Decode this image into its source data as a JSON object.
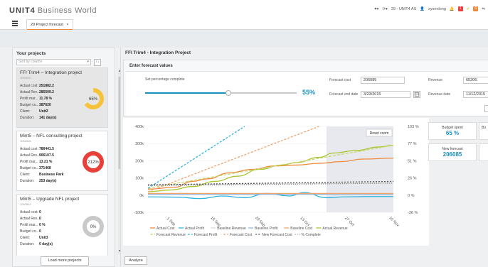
{
  "app": {
    "brand": "UNIT4",
    "product": "Business World"
  },
  "topbar": {
    "company": "29 - UNIT4 AS",
    "user": "sysenlong",
    "badge_1": "1",
    "badge_2": "0"
  },
  "tab": {
    "label": "29 Project forecast",
    "close": "×"
  },
  "left": {
    "title": "Your projects",
    "sort_placeholder": "Sort by column",
    "sort_dir": "↑↓",
    "projects": [
      {
        "title": "FFI Trim4 – Integration project",
        "code": "1054032",
        "rows": [
          [
            "Actual cost:",
            "251882.2"
          ],
          [
            "Actual Rev...",
            "285509.2"
          ],
          [
            "Profit mar...",
            "11.78 %"
          ],
          [
            "Budget co...",
            "387620"
          ],
          [
            "Client:",
            "Unit2"
          ],
          [
            "Duration:",
            "141 day(s)"
          ]
        ],
        "pct_label": "65%",
        "pct": 65,
        "color": "#f5c23a"
      },
      {
        "title": "Mint5 – NFL consulting project",
        "code": "1051528",
        "rows": [
          [
            "Actual cost:",
            "786441.5"
          ],
          [
            "Actual Rev...",
            "906107.5"
          ],
          [
            "Profit mar...",
            "13.21 %"
          ],
          [
            "Budget co...",
            "371468"
          ],
          [
            "Client:",
            "Business Park"
          ],
          [
            "Duration:",
            "253 day(s)"
          ]
        ],
        "pct_label": "212%",
        "pct": 100,
        "color": "#e8403b"
      },
      {
        "title": "Mint5 – Upgrade NFL project",
        "code": "1062841",
        "rows": [
          [
            "Actual cost:",
            "0"
          ],
          [
            "Actual Rev...",
            "0"
          ],
          [
            "Profit mar...",
            "0 %"
          ],
          [
            "Budget co...",
            "0"
          ],
          [
            "Client:",
            "Unit3"
          ],
          [
            "Duration:",
            "0 day(s)"
          ]
        ],
        "pct_label": "0%",
        "pct": 0,
        "color": "#c9c9c9"
      }
    ],
    "load_more": "Load more projects"
  },
  "main": {
    "title": "FFI Trim4 - Integration Project",
    "forecast_title": "Enter forecast values",
    "set_pct_label": "Set percentage complete",
    "pct_value": "55%",
    "pct_fraction": 0.55,
    "forecast_cost_label": "Forecast cost",
    "forecast_cost": "206085",
    "forecast_end_label": "Forecast end date",
    "forecast_end": "3/23/2015",
    "revenue_label": "Revenue",
    "revenue": "65206",
    "revenue_date_label": "Revenue date",
    "revenue_date": "11/12/2015",
    "analyze": "Analyze"
  },
  "kpis": {
    "budget_spent_label": "Budget spent",
    "budget_spent": "65 %",
    "new_forecast_label": "New forecast",
    "new_forecast": "206085",
    "partial_label": "Bu"
  },
  "chart_data": {
    "type": "line",
    "reset_zoom": "Reset zoom",
    "x": [
      "1 Sep",
      "15 Sep",
      "29 Sep",
      "13 Oct",
      "27 Oct",
      "10 Nov"
    ],
    "y_left_ticks": [
      "400k",
      "300k",
      "200k",
      "100k",
      "0k",
      "-100k"
    ],
    "y_left_range": [
      -100000,
      400000
    ],
    "y_right_ticks": [
      "103 %",
      "77 %",
      "51 %",
      "26 %",
      "0 %",
      "-26 %"
    ],
    "y_right_range": [
      -26,
      103
    ],
    "series": [
      {
        "name": "Actual Cost",
        "color": "#ef8a3c",
        "dash": "none",
        "values": [
          [
            0,
            35000
          ],
          [
            0.7,
            45000
          ],
          [
            1.2,
            80000
          ],
          [
            1.6,
            95000
          ],
          [
            2.2,
            130000
          ],
          [
            2.8,
            150000
          ],
          [
            3.4,
            170000
          ],
          [
            4,
            175000
          ],
          [
            4.6,
            185000
          ],
          [
            5.2,
            195000
          ],
          [
            5.8,
            210000
          ],
          [
            6.6,
            215000
          ]
        ]
      },
      {
        "name": "Actual Profit",
        "color": "#2fb3dd",
        "dash": "none",
        "values": [
          [
            0,
            -10000
          ],
          [
            0.8,
            -12000
          ],
          [
            1.4,
            -20000
          ],
          [
            2.0,
            -5000
          ],
          [
            2.6,
            -15000
          ],
          [
            3.2,
            10000
          ],
          [
            3.8,
            -5000
          ],
          [
            4.2,
            15000
          ],
          [
            4.8,
            -15000
          ],
          [
            5.3,
            -10000
          ],
          [
            6.0,
            -8000
          ],
          [
            6.6,
            -8000
          ]
        ]
      },
      {
        "name": "Baseline Revenue",
        "color": "#d8d8d8",
        "dash": "none",
        "values": [
          [
            0,
            60000
          ],
          [
            6.6,
            70000
          ]
        ]
      },
      {
        "name": "Baseline Profit",
        "color": "#9ab7d8",
        "dash": "none",
        "values": [
          [
            0,
            5000
          ],
          [
            6.6,
            5000
          ]
        ]
      },
      {
        "name": "Baseline Cost",
        "color": "#f0a36b",
        "dash": "none",
        "values": [
          [
            0,
            10000
          ],
          [
            6.6,
            10000
          ]
        ]
      },
      {
        "name": "Actual Revenue",
        "color": "#a8c532",
        "dash": "none",
        "values": [
          [
            0,
            20000
          ],
          [
            0.6,
            30000
          ],
          [
            1.2,
            50000
          ],
          [
            1.8,
            80000
          ],
          [
            2.4,
            110000
          ],
          [
            3.0,
            150000
          ],
          [
            3.6,
            175000
          ],
          [
            4.0,
            190000
          ],
          [
            4.6,
            220000
          ],
          [
            5.0,
            245000
          ],
          [
            5.6,
            260000
          ],
          [
            6.2,
            280000
          ],
          [
            6.6,
            290000
          ]
        ]
      },
      {
        "name": "Forecast Revenue",
        "color": "#c9d773",
        "dash": "4,2",
        "values": [
          [
            0,
            40000
          ],
          [
            6.6,
            290000
          ]
        ]
      },
      {
        "name": "Forecast Profit",
        "color": "#2fb3dd",
        "dash": "3,2",
        "values": [
          [
            0,
            40000
          ],
          [
            2.6,
            400000
          ]
        ]
      },
      {
        "name": "Forecast Cost",
        "color": "#f0a36b",
        "dash": "3,2",
        "values": [
          [
            0,
            20000
          ],
          [
            4.6,
            400000
          ]
        ]
      },
      {
        "name": "New Forecast Cost",
        "color": "#555555",
        "dash": "2,2",
        "values": [
          [
            0,
            60000
          ],
          [
            6.6,
            80000
          ]
        ]
      },
      {
        "name": "% Complete",
        "color": "#888888",
        "dash": "1,2",
        "values": [
          [
            0,
            55000
          ],
          [
            6.6,
            70000
          ]
        ]
      }
    ],
    "legend": [
      "Actual Cost",
      "Actual Profit",
      "Baseline Revenue",
      "Baseline Profit",
      "Baseline Cost",
      "Actual Revenue",
      "Forecast Revenue",
      "Forecast Profit",
      "Forecast Cost",
      "New Forecast Cost",
      "% Complete"
    ],
    "grid": true
  }
}
